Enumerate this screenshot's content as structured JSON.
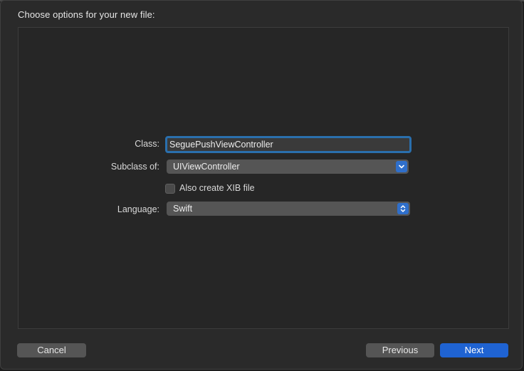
{
  "dialog": {
    "title": "Choose options for your new file:"
  },
  "form": {
    "class_label": "Class:",
    "class_value": "SeguePushViewController",
    "subclass_label": "Subclass of:",
    "subclass_value": "UIViewController",
    "xib_label": "Also create XIB file",
    "xib_checked": false,
    "language_label": "Language:",
    "language_value": "Swift"
  },
  "buttons": {
    "cancel": "Cancel",
    "previous": "Previous",
    "next": "Next"
  },
  "colors": {
    "accent": "#1f63d2",
    "focus_ring": "#2a6fad",
    "background": "#2a2a2a"
  },
  "icons": {
    "subclass_popup": "chevron-down-icon",
    "language_popup": "up-down-chevron-icon"
  }
}
